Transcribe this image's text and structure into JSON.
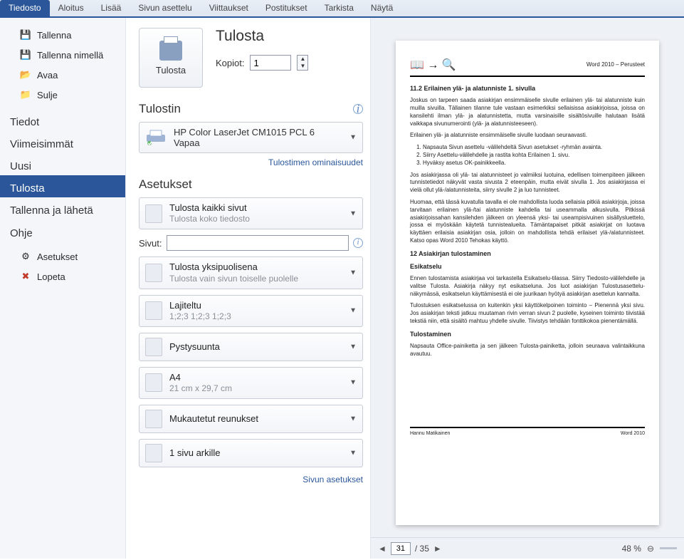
{
  "ribbon": {
    "tabs": [
      "Tiedosto",
      "Aloitus",
      "Lisää",
      "Sivun asettelu",
      "Viittaukset",
      "Postitukset",
      "Tarkista",
      "Näytä"
    ],
    "active": 0
  },
  "sidebar": {
    "quick": [
      {
        "label": "Tallenna",
        "icon": "💾"
      },
      {
        "label": "Tallenna nimellä",
        "icon": "💾"
      },
      {
        "label": "Avaa",
        "icon": "📂"
      },
      {
        "label": "Sulje",
        "icon": "📁"
      }
    ],
    "sections": [
      "Tiedot",
      "Viimeisimmät",
      "Uusi",
      "Tulosta",
      "Tallenna ja lähetä",
      "Ohje"
    ],
    "bottom": [
      {
        "label": "Asetukset",
        "icon": "⚙"
      },
      {
        "label": "Lopeta",
        "icon": "✖"
      }
    ],
    "selected": "Tulosta"
  },
  "print": {
    "title": "Tulosta",
    "button": "Tulosta",
    "copies_label": "Kopiot:",
    "copies": "1",
    "printer_section": "Tulostin",
    "printer_name": "HP Color LaserJet CM1015 PCL 6",
    "printer_status": "Vapaa",
    "printer_props": "Tulostimen ominaisuudet",
    "settings_section": "Asetukset",
    "pages_label": "Sivut:",
    "pages_value": "",
    "page_setup": "Sivun asetukset",
    "opts": [
      {
        "t1": "Tulosta kaikki sivut",
        "t2": "Tulosta koko tiedosto"
      },
      {
        "t1": "Tulosta yksipuolisena",
        "t2": "Tulosta vain sivun toiselle puolelle"
      },
      {
        "t1": "Lajiteltu",
        "t2": "1;2;3    1;2;3    1;2;3"
      },
      {
        "t1": "Pystysuunta",
        "t2": ""
      },
      {
        "t1": "A4",
        "t2": "21 cm x 29,7 cm"
      },
      {
        "t1": "Mukautetut reunukset",
        "t2": ""
      },
      {
        "t1": "1 sivu arkille",
        "t2": ""
      }
    ]
  },
  "preview": {
    "page_current": "31",
    "page_total": "/ 35",
    "zoom": "48 %",
    "doc": {
      "header_right": "Word 2010  – Perusteet",
      "h1": "11.2 Erilainen ylä- ja alatunniste 1. sivulla",
      "p1": "Joskus on tarpeen saada asiakirjan ensimmäiselle sivulle erilainen ylä- tai alatunniste kuin muilla sivuilla. Tällainen tilanne tule vastaan esimerkiksi sellaisissa asiakirjoissa, joissa on kansilehti ilman ylä- ja alatunnistetta, mutta varsinaisille sisältösivuille halutaan lisätä vaikkapa sivunumerointi (ylä- ja alatunnisteeseen).",
      "p2": "Erilainen ylä- ja alatunniste ensimmäiselle sivulle luodaan seuraavasti.",
      "steps": [
        "Napsauta Sivun asettelu -välilehdeltä Sivun asetukset -ryhmän avainta.",
        "Siirry Asettelu-välilehdelle ja rastita kohta Erilainen 1. sivu.",
        "Hyväksy asetus OK-painikkeella."
      ],
      "p3": "Jos asiakirjassa oli ylä- tai alatunnisteet jo valmiiksi luotuina, edellisen toimenpiteen jälkeen tunnistetiedot näkyvät vasta sivusta 2 eteenpäin, mutta eivät sivulla 1. Jos asiakirjassa ei vielä ollut ylä-/alatunnisteita, siirry sivulle 2 ja luo tunnisteet.",
      "p4": "Huomaa, että tässä kuvatulla tavalla ei ole mahdollista luoda sellaisia pitkiä asiakirjoja, joissa tarvitaan erilainen ylä-/tai alatunniste kahdella tai useammalla alkusivulla. Pitkissä asiakirjoissahan kansilehden jälkeen on yleensä yksi- tai useampisivuinen sisällysluettelo, jossa ei myöskään käytetä tunnistealueita. Tämäntapaiset pitkät asiakirjat on luotava käyttäen erilaisia asiakirjan osia, jolloin on mahdollista tehdä erilaiset ylä-/alatunnisteet. Katso opas Word 2010 Tehokas käyttö.",
      "h2": "12 Asiakirjan tulostaminen",
      "h3": "Esikatselu",
      "p5": "Ennen tulostamista asiakirjaa voi tarkastella Esikatselu-tilassa. Siirry Tiedosto-välilehdelle ja valitse Tulosta. Asiakirja näkyy nyt esikatseluna. Jos luot asiakirjan Tulostusasettelu-näkymässä, esikatselun käyttämisestä ei ole juurikaan hyötyä asiakirjan asettelun kannalta.",
      "p6": "Tulostuksen esikatselussa on kuitenkin yksi käyttökelpoinen toiminto – Pienennä yksi sivu. Jos asiakirjan teksti jatkuu muutaman rivin verran sivun 2 puolelle, kyseinen toiminto tiivistää tekstiä niin, että sisältö mahtuu yhdelle sivulle. Tiivistys tehdään fonttikokoa pienentämällä.",
      "h4": "Tulostaminen",
      "p7": "Napsauta Office-painiketta ja sen jälkeen Tulosta-painiketta, jolloin seuraava valintaikkuna avautuu.",
      "footer_left": "Hannu  Matikainen",
      "footer_right": "Word 2010"
    }
  }
}
